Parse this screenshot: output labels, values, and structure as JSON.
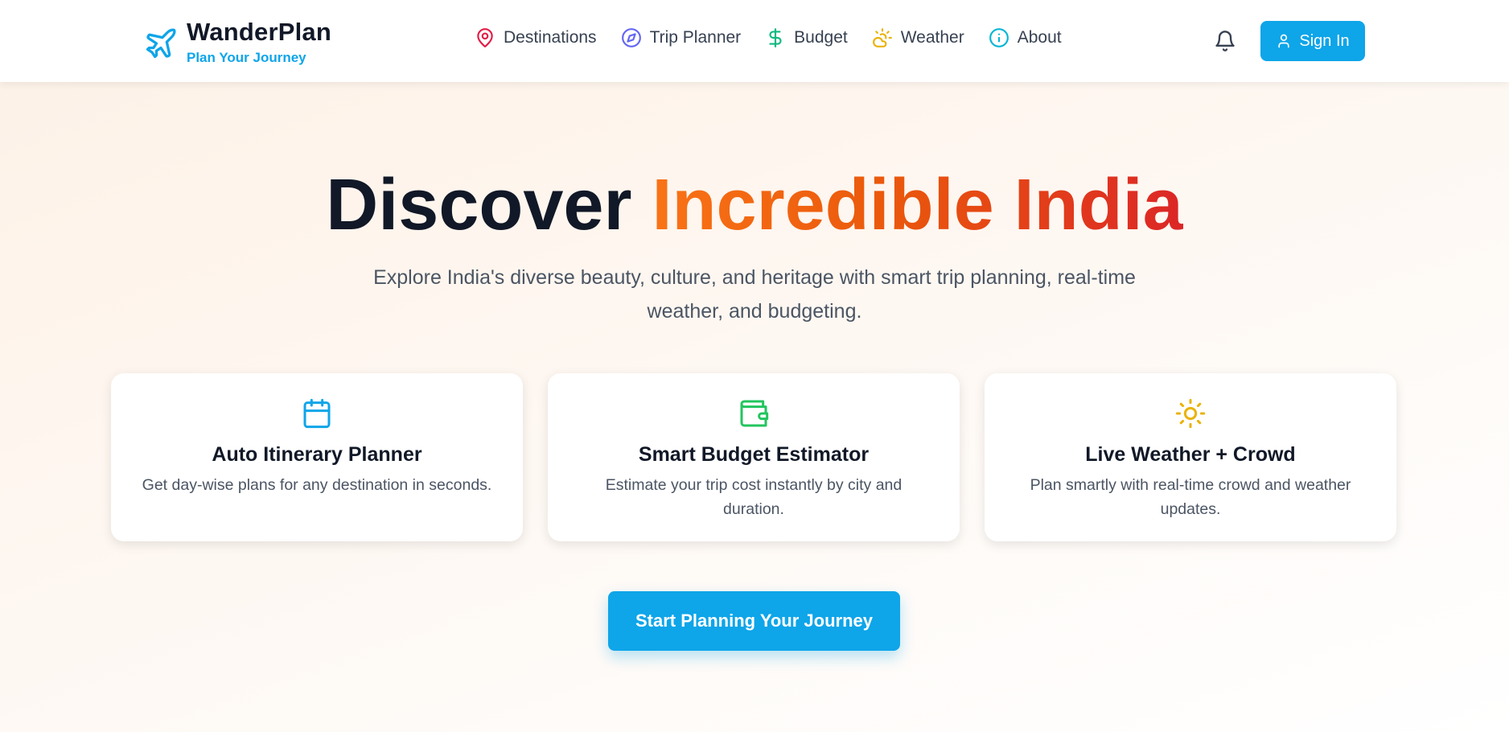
{
  "header": {
    "brand_name": "WanderPlan",
    "brand_tagline": "Plan Your Journey",
    "nav": [
      {
        "label": "Destinations",
        "icon": "map-pin-icon",
        "color": "#e11d48"
      },
      {
        "label": "Trip Planner",
        "icon": "compass-icon",
        "color": "#6366f1"
      },
      {
        "label": "Budget",
        "icon": "dollar-icon",
        "color": "#10b981"
      },
      {
        "label": "Weather",
        "icon": "cloud-sun-icon",
        "color": "#eab308"
      },
      {
        "label": "About",
        "icon": "info-icon",
        "color": "#06b6d4"
      }
    ],
    "bell_icon": "bell-icon",
    "signin_label": "Sign In"
  },
  "hero": {
    "title_part1": "Discover",
    "title_part2": "Incredible India",
    "subtitle": "Explore India's diverse beauty, culture, and heritage with smart trip planning, real-time weather, and budgeting."
  },
  "features": [
    {
      "icon": "calendar-icon",
      "color": "#0ea5e9",
      "title": "Auto Itinerary Planner",
      "description": "Get day-wise plans for any destination in seconds."
    },
    {
      "icon": "wallet-icon",
      "color": "#22c55e",
      "title": "Smart Budget Estimator",
      "description": "Estimate your trip cost instantly by city and duration."
    },
    {
      "icon": "sun-icon",
      "color": "#eab308",
      "title": "Live Weather + Crowd",
      "description": "Plan smartly with real-time crowd and weather updates."
    }
  ],
  "cta_label": "Start Planning Your Journey",
  "colors": {
    "primary": "#0ea5e9",
    "gradient_start": "#f97316",
    "gradient_end": "#dc2626"
  }
}
